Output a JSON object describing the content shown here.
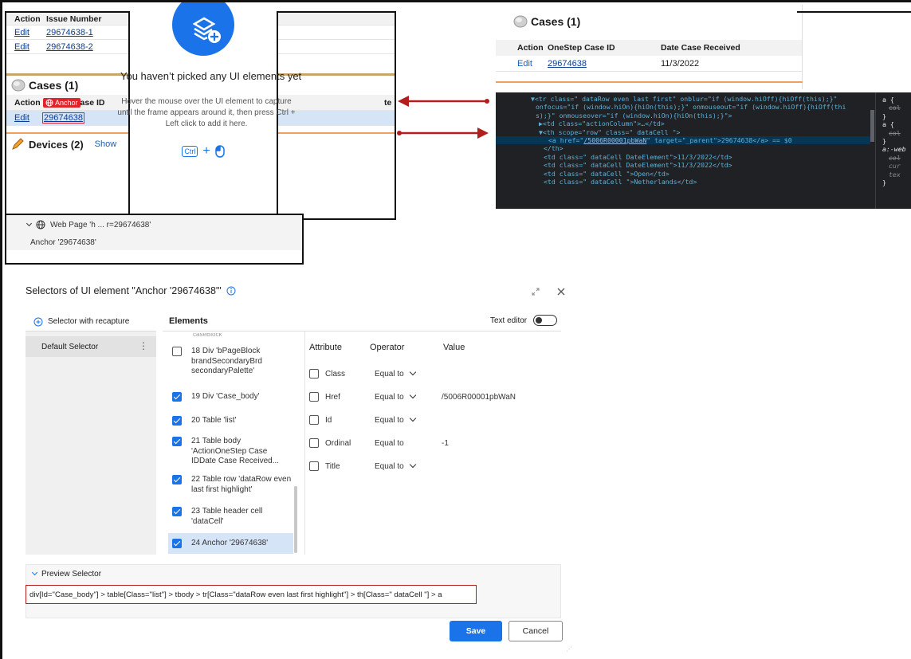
{
  "top_left": {
    "header": {
      "action": "Action",
      "issue_number": "Issue Number"
    },
    "issues": [
      {
        "action": "Edit",
        "number": "29674638-1"
      },
      {
        "action": "Edit",
        "number": "29674638-2"
      }
    ],
    "cases_title": "Cases (1)",
    "cases_header": {
      "action": "Action",
      "anchor_badge": "Anchor",
      "case_id_partial": "ase ID",
      "date_partial": "te"
    },
    "case_row": {
      "action": "Edit",
      "id": "29674638"
    },
    "devices_title": "Devices (2)",
    "devices_link": "Show"
  },
  "overlay": {
    "title": "You haven’t picked any UI elements yet",
    "hint": "Hover the mouse over the UI element to capture until the frame appears around it, then press Ctrl + Left click to add it here.",
    "kbd": "Ctrl",
    "plus": "+"
  },
  "top_right": {
    "cases_title": "Cases (1)",
    "header": {
      "action": "Action",
      "case_id": "OneStep Case ID",
      "date": "Date Case Received"
    },
    "row": {
      "action": "Edit",
      "id": "29674638",
      "date": "11/3/2022"
    },
    "devtools": {
      "line1a": "▼<tr class=\" dataRow even last first\" onblur=\"if (window.hiOff){hiOff(this);}\"",
      "line1b": "onfocus=\"if (window.hiOn){hiOn(this);}\" onmouseout=\"if (window.hiOff){hiOff(thi",
      "line1c": "s);}\" onmouseover=\"if (window.hiOn){hiOn(this);}\">",
      "line2": "▶<td class=\"actionColumn\">…</td>",
      "line3": "▼<th scope=\"row\" class=\" dataCell  \">",
      "line4_pre": "<a href=\"",
      "line4_href": "/5006R00001pbWaN",
      "line4_post": "\" target=\"_parent\">29674638</a> == $0",
      "line5": "</th>",
      "line6": "<td class=\" dataCell  DateElement\">11/3/2022</td>",
      "line7": "<td class=\" dataCell  DateElement\">11/3/2022</td>",
      "line8": "<td class=\" dataCell  \">Open</td>",
      "line9": "<td class=\" dataCell  \">Netherlands</td>",
      "side1": "a {",
      "side2": "col",
      "side3": "}",
      "side4": "a {",
      "side5": "col",
      "side6": "}",
      "side7": "a:-web",
      "side8": "col",
      "side9": "cur",
      "side10": "tex",
      "side11": "}"
    }
  },
  "tree": {
    "page": "Web Page 'h ... r=29674638'",
    "anchor": "Anchor '29674638'"
  },
  "dialog": {
    "title": "Selectors of UI element \"Anchor '29674638'\"",
    "selector_with_recapture": "Selector with recapture",
    "elements_header": "Elements",
    "text_editor": "Text editor",
    "default_selector": "Default Selector",
    "partial_top": "caseBlock",
    "elements": [
      {
        "label": "18  Div 'bPageBlock brandSecondaryBrd secondaryPalette'",
        "checked": false
      },
      {
        "label": "19  Div 'Case_body'",
        "checked": true
      },
      {
        "label": "20  Table 'list'",
        "checked": true
      },
      {
        "label": "21  Table body 'ActionOneStep Case IDDate Case Received...",
        "checked": true
      },
      {
        "label": "22  Table row 'dataRow even last first highlight'",
        "checked": true
      },
      {
        "label": "23  Table header cell 'dataCell'",
        "checked": true
      },
      {
        "label": "24  Anchor '29674638'",
        "checked": true
      }
    ],
    "attr_header": {
      "attribute": "Attribute",
      "operator": "Operator",
      "value": "Value"
    },
    "attributes": [
      {
        "name": "Class",
        "operator": "Equal to",
        "value": ""
      },
      {
        "name": "Href",
        "operator": "Equal to",
        "value": "/5006R00001pbWaN"
      },
      {
        "name": "Id",
        "operator": "Equal to",
        "value": ""
      },
      {
        "name": "Ordinal",
        "operator": "Equal to",
        "value": "-1"
      },
      {
        "name": "Title",
        "operator": "Equal to",
        "value": ""
      }
    ],
    "preview_label": "Preview Selector",
    "preview_value": "div[Id=\"Case_body\"] > table[Class=\"list\"] > tbody > tr[Class=\"dataRow even last first highlight\"] > th[Class=\" dataCell  \"] > a",
    "save": "Save",
    "cancel": "Cancel"
  },
  "colors": {
    "accent": "#1a73e8",
    "arrow": "#b01e1e",
    "highlight": "#d6e4f7"
  }
}
